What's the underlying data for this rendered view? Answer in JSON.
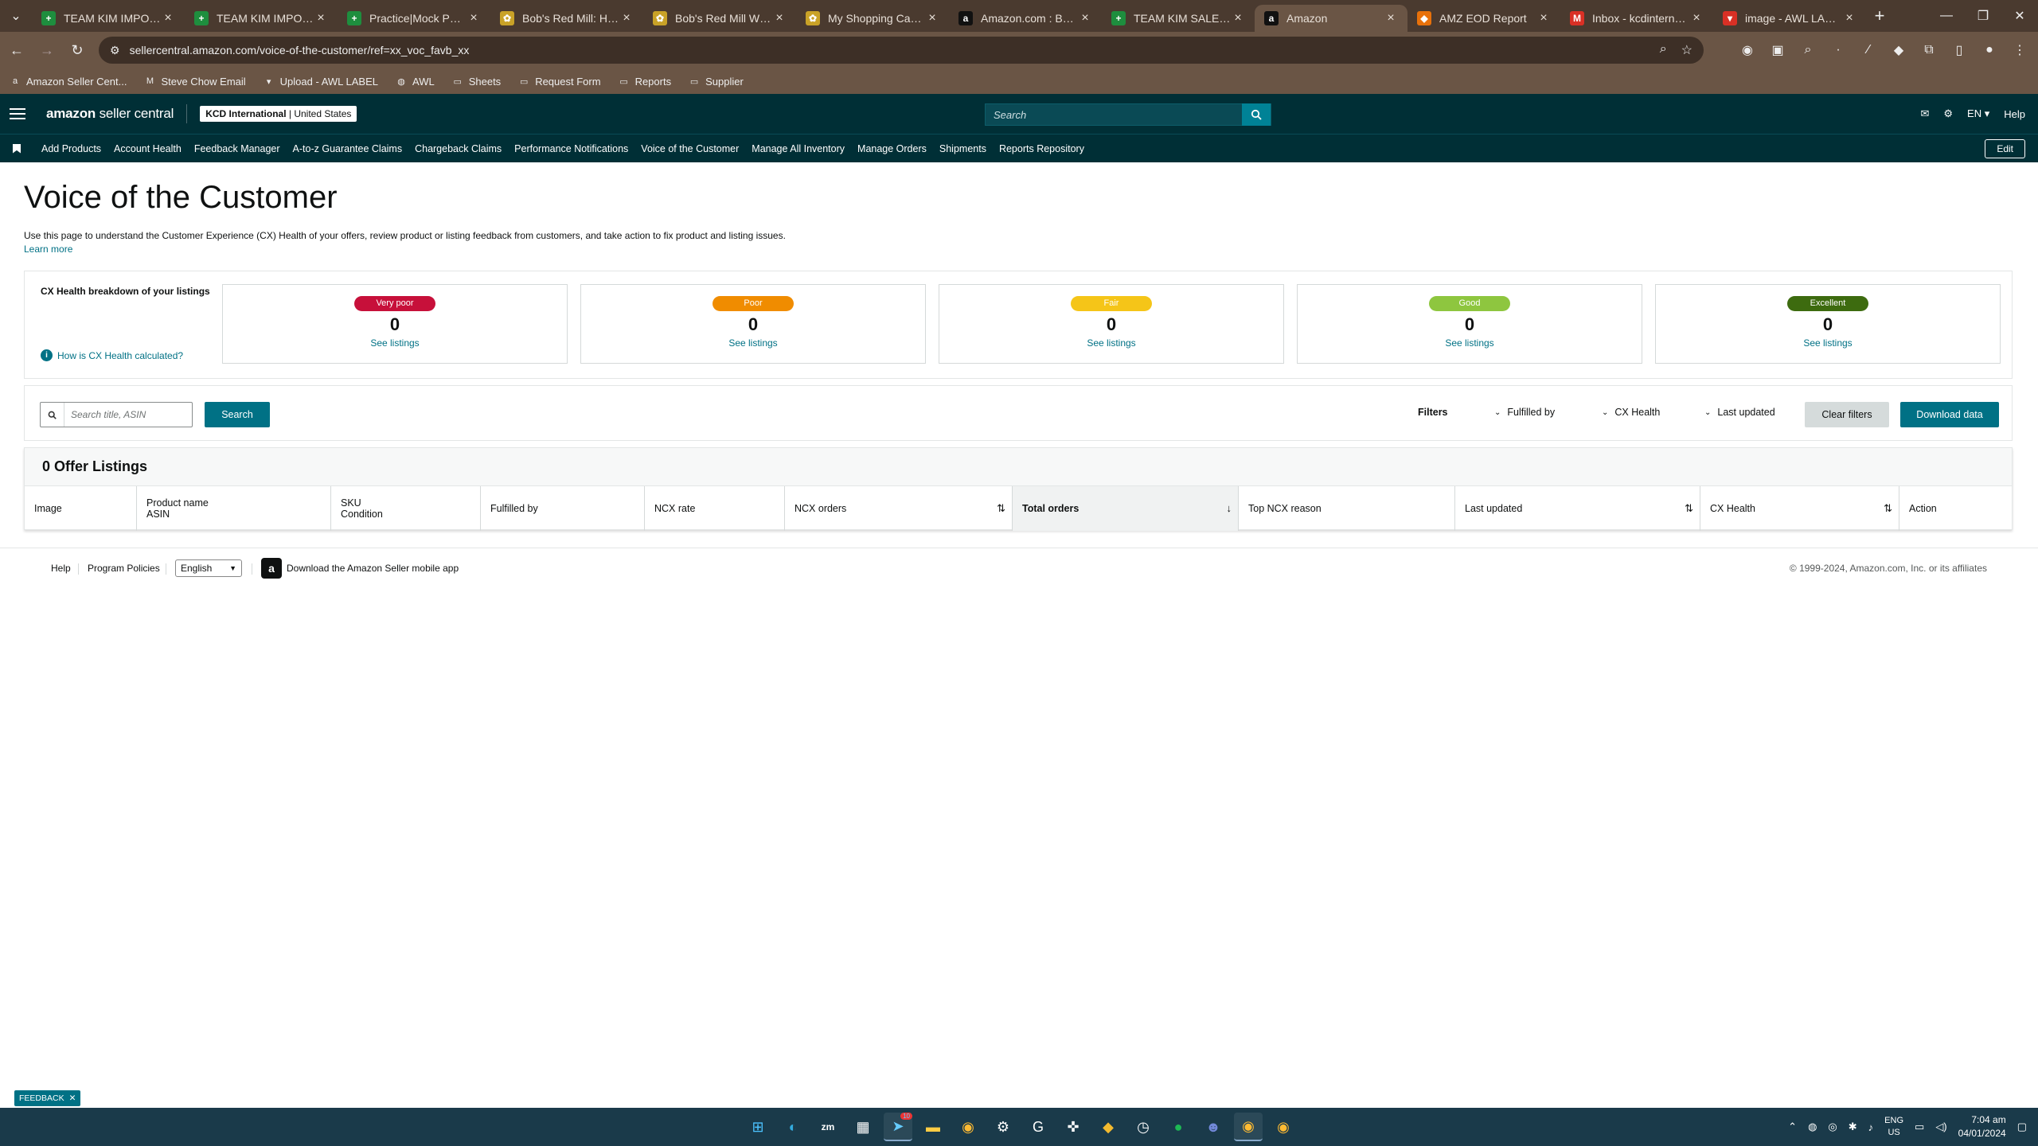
{
  "browser": {
    "tabs": [
      {
        "title": "TEAM KIM IMPORTANT",
        "fav_color": "#1e8e3e",
        "fav_glyph": "+"
      },
      {
        "title": "TEAM KIM IMPORTANT",
        "fav_color": "#1e8e3e",
        "fav_glyph": "+"
      },
      {
        "title": "Practice|Mock PR - Goo",
        "fav_color": "#1e8e3e",
        "fav_glyph": "+"
      },
      {
        "title": "Bob's Red Mill: Healthy",
        "fav_color": "#c9a227",
        "fav_glyph": "✿"
      },
      {
        "title": "Bob's Red Mill Whole W",
        "fav_color": "#c9a227",
        "fav_glyph": "✿"
      },
      {
        "title": "My Shopping Cart - Vit",
        "fav_color": "#c9a227",
        "fav_glyph": "✿"
      },
      {
        "title": "Amazon.com : Bob's Re",
        "fav_color": "#111111",
        "fav_glyph": "a"
      },
      {
        "title": "TEAM KIM SALES MONT",
        "fav_color": "#1e8e3e",
        "fav_glyph": "+"
      },
      {
        "title": "Amazon",
        "fav_color": "#111111",
        "fav_glyph": "a"
      },
      {
        "title": "AMZ EOD Report",
        "fav_color": "#e8710a",
        "fav_glyph": "◆"
      },
      {
        "title": "Inbox - kcdinternationa",
        "fav_color": "#d93025",
        "fav_glyph": "M"
      },
      {
        "title": "image - AWL LABEL",
        "fav_color": "#d93025",
        "fav_glyph": "▾"
      }
    ],
    "active_tab": 8,
    "url": "sellercentral.amazon.com/voice-of-the-customer/ref=xx_voc_favb_xx",
    "bookmarks": [
      {
        "label": "Amazon Seller Cent...",
        "icon": "amazon-icon"
      },
      {
        "label": "Steve Chow Email",
        "icon": "gmail-icon"
      },
      {
        "label": "Upload - AWL LABEL",
        "icon": "label-icon"
      },
      {
        "label": "AWL",
        "icon": "globe-icon"
      },
      {
        "label": "Sheets",
        "icon": "folder-icon"
      },
      {
        "label": "Request Form",
        "icon": "folder-icon"
      },
      {
        "label": "Reports",
        "icon": "folder-icon"
      },
      {
        "label": "Supplier",
        "icon": "folder-icon"
      }
    ]
  },
  "header": {
    "logo_bold": "amazon",
    "logo_rest": " seller central",
    "account_name": "KCD International",
    "account_region": "United States",
    "search_placeholder": "Search",
    "lang": "EN",
    "help": "Help"
  },
  "nav": {
    "items": [
      "Add Products",
      "Account Health",
      "Feedback Manager",
      "A-to-z Guarantee Claims",
      "Chargeback Claims",
      "Performance Notifications",
      "Voice of the Customer",
      "Manage All Inventory",
      "Manage Orders",
      "Shipments",
      "Reports Repository"
    ],
    "edit": "Edit"
  },
  "page": {
    "title": "Voice of the Customer",
    "intro": "Use this page to understand the Customer Experience (CX) Health of your offers, review product or listing feedback from customers, and take action to fix product and listing issues.",
    "learn_more": "Learn more"
  },
  "cx_health": {
    "label": "CX Health breakdown of your listings",
    "how_link": "How is CX Health calculated?",
    "cards": [
      {
        "label": "Very poor",
        "count": "0",
        "link": "See listings",
        "color": "#c7103a"
      },
      {
        "label": "Poor",
        "count": "0",
        "link": "See listings",
        "color": "#f08c00"
      },
      {
        "label": "Fair",
        "count": "0",
        "link": "See listings",
        "color": "#f5c518"
      },
      {
        "label": "Good",
        "count": "0",
        "link": "See listings",
        "color": "#8ec63f"
      },
      {
        "label": "Excellent",
        "count": "0",
        "link": "See listings",
        "color": "#3d6b0f"
      }
    ]
  },
  "filters": {
    "search_placeholder": "Search title, ASIN",
    "search_button": "Search",
    "filters_label": "Filters",
    "fulfilled_by": "Fulfilled by",
    "cx_health": "CX Health",
    "last_updated": "Last updated",
    "clear": "Clear filters",
    "download": "Download data"
  },
  "table": {
    "heading": "0 Offer Listings",
    "columns": [
      {
        "line1": "Image",
        "line2": ""
      },
      {
        "line1": "Product name",
        "line2": "ASIN"
      },
      {
        "line1": "SKU",
        "line2": "Condition"
      },
      {
        "line1": "Fulfilled by",
        "line2": ""
      },
      {
        "line1": "NCX rate",
        "line2": ""
      },
      {
        "line1": "NCX orders",
        "line2": ""
      },
      {
        "line1": "Total orders",
        "line2": ""
      },
      {
        "line1": "Top NCX reason",
        "line2": ""
      },
      {
        "line1": "Last updated",
        "line2": ""
      },
      {
        "line1": "CX Health",
        "line2": ""
      },
      {
        "line1": "Action",
        "line2": ""
      }
    ]
  },
  "footer": {
    "help": "Help",
    "policies": "Program Policies",
    "language": "English",
    "app": "Download the Amazon Seller mobile app",
    "copyright": "© 1999-2024, Amazon.com, Inc. or its affiliates"
  },
  "feedback": "FEEDBACK",
  "taskbar": {
    "badge": "10",
    "lang1": "ENG",
    "lang2": "US",
    "time": "7:04 am",
    "date": "04/01/2024"
  }
}
